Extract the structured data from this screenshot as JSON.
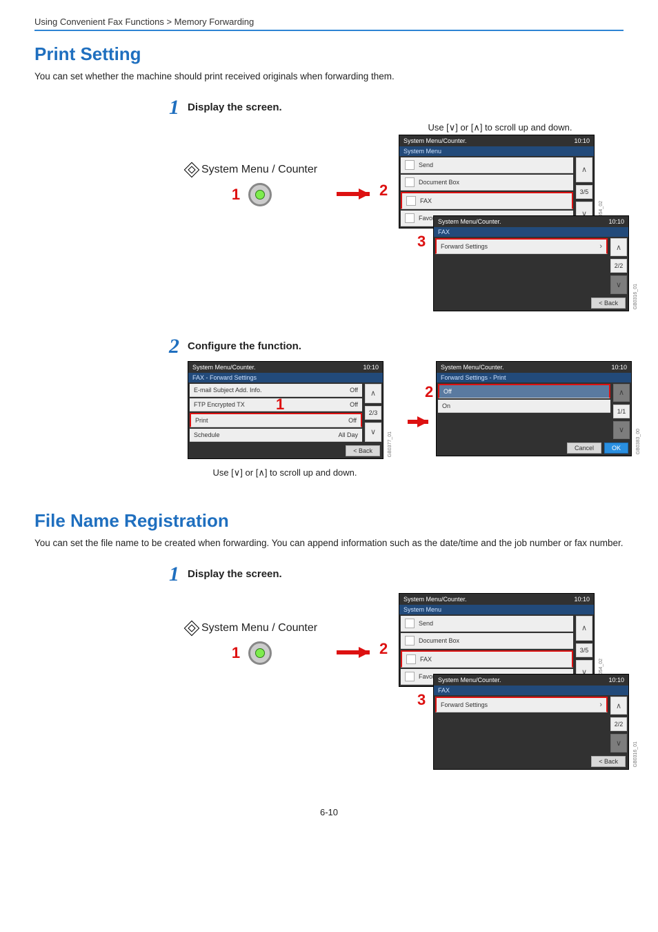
{
  "breadcrumb": "Using Convenient Fax Functions > Memory Forwarding",
  "section1": {
    "heading": "Print Setting",
    "intro": "You can set whether the machine should print received originals when forwarding them.",
    "step1_title": "Display the screen.",
    "step2_title": "Configure the function."
  },
  "section2": {
    "heading": "File Name Registration",
    "intro": "You can set the file name to be created when forwarding. You can append information such as the date/time and the job number or fax number.",
    "step1_title": "Display the screen."
  },
  "common": {
    "scroll_hint_v": "Use [∨] or [∧] to scroll up and down.",
    "sysmenu_label": "System Menu / Counter",
    "back": "< Back",
    "cancel": "Cancel",
    "ok": "OK"
  },
  "screen_sysmenu": {
    "title": "System Menu/Counter.",
    "time": "10:10",
    "subtitle": "System Menu",
    "items": [
      "Send",
      "Document Box",
      "FAX",
      "Favorites/Application"
    ],
    "page": "3/5",
    "vlabel": "GB0054_02",
    "highlight_index": 2
  },
  "screen_fax": {
    "title": "System Menu/Counter.",
    "time": "10:10",
    "subtitle": "FAX",
    "items": [
      "Forward Settings"
    ],
    "page": "2/2",
    "vlabel": "GB0316_01"
  },
  "screen_fwd_settings": {
    "title": "System Menu/Counter.",
    "time": "10:10",
    "subtitle": "FAX - Forward Settings",
    "rows": [
      {
        "label": "E-mail Subject Add. Info.",
        "value": "Off"
      },
      {
        "label": "FTP Encrypted TX",
        "value": "Off"
      },
      {
        "label": "Print",
        "value": "Off"
      },
      {
        "label": "Schedule",
        "value": "All Day"
      }
    ],
    "page": "2/3",
    "vlabel": "GB0377_01",
    "highlight_index": 2
  },
  "screen_print_opt": {
    "title": "System Menu/Counter.",
    "time": "10:10",
    "subtitle": "Forward Settings - Print",
    "options": [
      "Off",
      "On"
    ],
    "page": "1/1",
    "vlabel": "GB0383_00",
    "highlight_index": 0
  },
  "step_markers": {
    "m1": "1",
    "m2": "2",
    "m3": "3"
  },
  "page_number": "6-10"
}
